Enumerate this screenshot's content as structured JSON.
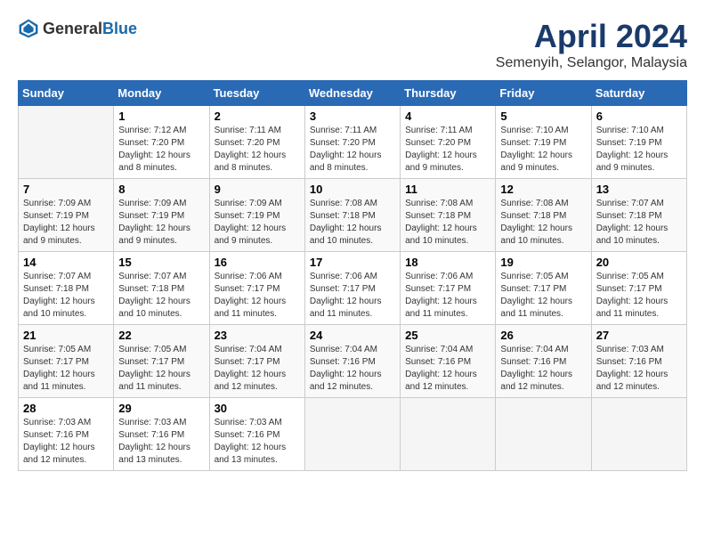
{
  "header": {
    "logo_general": "General",
    "logo_blue": "Blue",
    "title": "April 2024",
    "subtitle": "Semenyih, Selangor, Malaysia"
  },
  "calendar": {
    "days_of_week": [
      "Sunday",
      "Monday",
      "Tuesday",
      "Wednesday",
      "Thursday",
      "Friday",
      "Saturday"
    ],
    "weeks": [
      [
        {
          "day": "",
          "info": ""
        },
        {
          "day": "1",
          "info": "Sunrise: 7:12 AM\nSunset: 7:20 PM\nDaylight: 12 hours and 8 minutes."
        },
        {
          "day": "2",
          "info": "Sunrise: 7:11 AM\nSunset: 7:20 PM\nDaylight: 12 hours and 8 minutes."
        },
        {
          "day": "3",
          "info": "Sunrise: 7:11 AM\nSunset: 7:20 PM\nDaylight: 12 hours and 8 minutes."
        },
        {
          "day": "4",
          "info": "Sunrise: 7:11 AM\nSunset: 7:20 PM\nDaylight: 12 hours and 9 minutes."
        },
        {
          "day": "5",
          "info": "Sunrise: 7:10 AM\nSunset: 7:19 PM\nDaylight: 12 hours and 9 minutes."
        },
        {
          "day": "6",
          "info": "Sunrise: 7:10 AM\nSunset: 7:19 PM\nDaylight: 12 hours and 9 minutes."
        }
      ],
      [
        {
          "day": "7",
          "info": "Sunrise: 7:09 AM\nSunset: 7:19 PM\nDaylight: 12 hours and 9 minutes."
        },
        {
          "day": "8",
          "info": "Sunrise: 7:09 AM\nSunset: 7:19 PM\nDaylight: 12 hours and 9 minutes."
        },
        {
          "day": "9",
          "info": "Sunrise: 7:09 AM\nSunset: 7:19 PM\nDaylight: 12 hours and 9 minutes."
        },
        {
          "day": "10",
          "info": "Sunrise: 7:08 AM\nSunset: 7:18 PM\nDaylight: 12 hours and 10 minutes."
        },
        {
          "day": "11",
          "info": "Sunrise: 7:08 AM\nSunset: 7:18 PM\nDaylight: 12 hours and 10 minutes."
        },
        {
          "day": "12",
          "info": "Sunrise: 7:08 AM\nSunset: 7:18 PM\nDaylight: 12 hours and 10 minutes."
        },
        {
          "day": "13",
          "info": "Sunrise: 7:07 AM\nSunset: 7:18 PM\nDaylight: 12 hours and 10 minutes."
        }
      ],
      [
        {
          "day": "14",
          "info": "Sunrise: 7:07 AM\nSunset: 7:18 PM\nDaylight: 12 hours and 10 minutes."
        },
        {
          "day": "15",
          "info": "Sunrise: 7:07 AM\nSunset: 7:18 PM\nDaylight: 12 hours and 10 minutes."
        },
        {
          "day": "16",
          "info": "Sunrise: 7:06 AM\nSunset: 7:17 PM\nDaylight: 12 hours and 11 minutes."
        },
        {
          "day": "17",
          "info": "Sunrise: 7:06 AM\nSunset: 7:17 PM\nDaylight: 12 hours and 11 minutes."
        },
        {
          "day": "18",
          "info": "Sunrise: 7:06 AM\nSunset: 7:17 PM\nDaylight: 12 hours and 11 minutes."
        },
        {
          "day": "19",
          "info": "Sunrise: 7:05 AM\nSunset: 7:17 PM\nDaylight: 12 hours and 11 minutes."
        },
        {
          "day": "20",
          "info": "Sunrise: 7:05 AM\nSunset: 7:17 PM\nDaylight: 12 hours and 11 minutes."
        }
      ],
      [
        {
          "day": "21",
          "info": "Sunrise: 7:05 AM\nSunset: 7:17 PM\nDaylight: 12 hours and 11 minutes."
        },
        {
          "day": "22",
          "info": "Sunrise: 7:05 AM\nSunset: 7:17 PM\nDaylight: 12 hours and 11 minutes."
        },
        {
          "day": "23",
          "info": "Sunrise: 7:04 AM\nSunset: 7:17 PM\nDaylight: 12 hours and 12 minutes."
        },
        {
          "day": "24",
          "info": "Sunrise: 7:04 AM\nSunset: 7:16 PM\nDaylight: 12 hours and 12 minutes."
        },
        {
          "day": "25",
          "info": "Sunrise: 7:04 AM\nSunset: 7:16 PM\nDaylight: 12 hours and 12 minutes."
        },
        {
          "day": "26",
          "info": "Sunrise: 7:04 AM\nSunset: 7:16 PM\nDaylight: 12 hours and 12 minutes."
        },
        {
          "day": "27",
          "info": "Sunrise: 7:03 AM\nSunset: 7:16 PM\nDaylight: 12 hours and 12 minutes."
        }
      ],
      [
        {
          "day": "28",
          "info": "Sunrise: 7:03 AM\nSunset: 7:16 PM\nDaylight: 12 hours and 12 minutes."
        },
        {
          "day": "29",
          "info": "Sunrise: 7:03 AM\nSunset: 7:16 PM\nDaylight: 12 hours and 13 minutes."
        },
        {
          "day": "30",
          "info": "Sunrise: 7:03 AM\nSunset: 7:16 PM\nDaylight: 12 hours and 13 minutes."
        },
        {
          "day": "",
          "info": ""
        },
        {
          "day": "",
          "info": ""
        },
        {
          "day": "",
          "info": ""
        },
        {
          "day": "",
          "info": ""
        }
      ]
    ]
  }
}
